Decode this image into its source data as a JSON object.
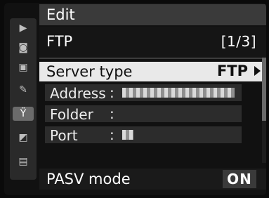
{
  "header": {
    "title": "Edit"
  },
  "menu": {
    "title": "FTP",
    "page_indicator": "[1/3]"
  },
  "items": {
    "server_type": {
      "label": "Server type",
      "value": "FTP"
    },
    "address": {
      "label": "Address",
      "colon": ":"
    },
    "folder": {
      "label": "Folder",
      "colon": ":"
    },
    "port": {
      "label": "Port",
      "colon": ":"
    },
    "pasv": {
      "label": "PASV mode",
      "value": "ON"
    }
  },
  "sidebar": {
    "icons": [
      "playback-icon",
      "camera-icon",
      "movie-icon",
      "pencil-icon",
      "wrench-icon",
      "retouch-icon",
      "recent-settings-icon"
    ],
    "active_index": 4
  }
}
